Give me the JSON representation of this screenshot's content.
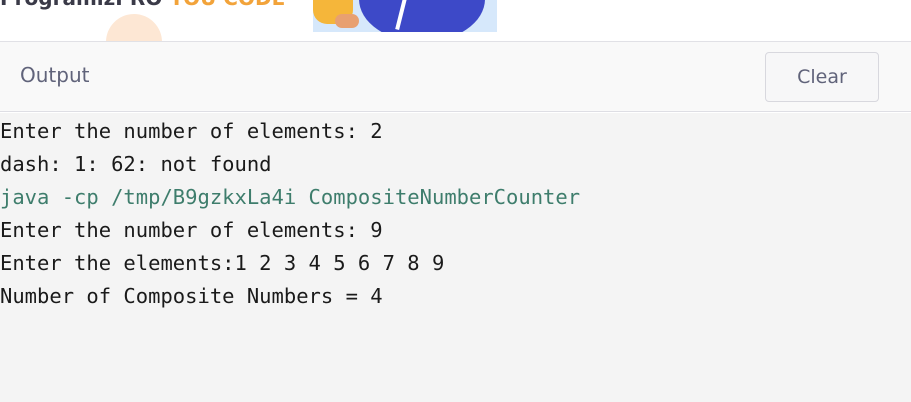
{
  "banner": {
    "title_start": "ProgramizPRO",
    "title_highlight": "YOU CODE"
  },
  "output_panel": {
    "title": "Output",
    "clear_label": "Clear"
  },
  "console": {
    "lines": [
      {
        "text": "Enter the number of elements: 2",
        "kind": "stdout"
      },
      {
        "text": "dash: 1: 62: not found",
        "kind": "stdout"
      },
      {
        "text": "java -cp /tmp/B9gzkxLa4i CompositeNumberCounter",
        "kind": "command"
      },
      {
        "text": "Enter the number of elements: 9",
        "kind": "stdout"
      },
      {
        "text": "Enter the elements:1 2 3 4 5 6 7 8 9",
        "kind": "stdout"
      },
      {
        "text": "Number of Composite Numbers = 4",
        "kind": "stdout"
      }
    ]
  },
  "colors": {
    "command_text": "#3e7d6c",
    "console_bg": "#f4f4f4",
    "header_text": "#60637a"
  }
}
